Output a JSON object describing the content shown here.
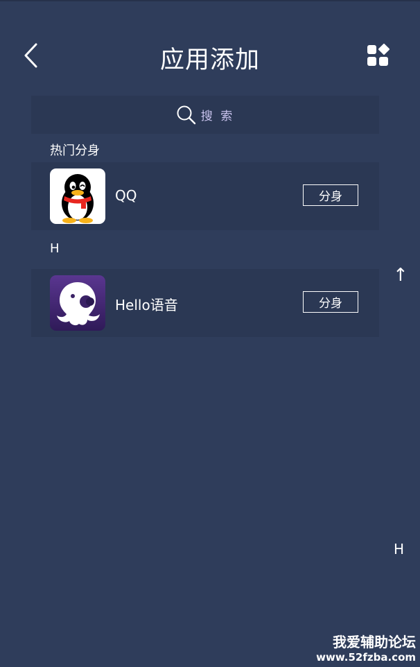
{
  "header": {
    "title": "应用添加",
    "back_icon": "chevron-left-icon",
    "apps_icon": "app-grid-icon"
  },
  "search": {
    "label": "搜 索",
    "icon": "search-icon"
  },
  "sections": [
    {
      "label": "热门分身",
      "apps": [
        {
          "name": "QQ",
          "icon": "qq-penguin-icon",
          "button_label": "分身"
        }
      ]
    },
    {
      "label": "H",
      "apps": [
        {
          "name": "Hello语音",
          "icon": "hello-voice-octopus-icon",
          "button_label": "分身"
        }
      ]
    }
  ],
  "index_bar": {
    "up_arrow": "↑",
    "letters": [
      "H"
    ]
  },
  "watermark": {
    "line1": "我爱辅助论坛",
    "line2": "www.52fzba.com"
  },
  "colors": {
    "background": "#2f3d5b",
    "row_background": "#2b3854",
    "search_text": "#c9c3ee",
    "hello_icon_bg": "#4b2a78"
  }
}
